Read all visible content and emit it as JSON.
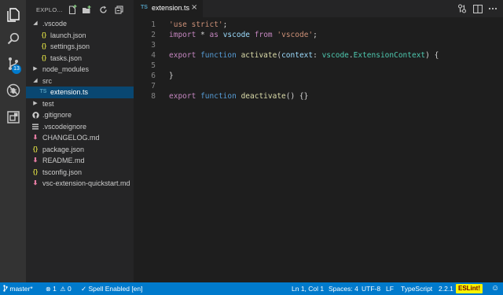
{
  "colors": {
    "activity_bar": "#333333",
    "sidebar": "#252526",
    "editor": "#1e1e1e",
    "selection": "#094771",
    "status_bar": "#007acc",
    "badge": "#007acc",
    "eslint_bg": "#f9f300",
    "eslint_fg": "#6c0000"
  },
  "activity": {
    "items": [
      {
        "icon": "files-icon"
      },
      {
        "icon": "search-icon"
      },
      {
        "icon": "source-control-icon",
        "badge": "13"
      },
      {
        "icon": "debug-icon"
      },
      {
        "icon": "extensions-icon"
      }
    ]
  },
  "sidebar": {
    "title": "EXPLO...",
    "header_icons": [
      "new-file-icon",
      "new-folder-icon",
      "refresh-icon",
      "collapse-all-icon"
    ],
    "tree": [
      {
        "label": ".vscode",
        "type": "folder",
        "expanded": true
      },
      {
        "label": "launch.json",
        "type": "json"
      },
      {
        "label": "settings.json",
        "type": "json"
      },
      {
        "label": "tasks.json",
        "type": "json"
      },
      {
        "label": "node_modules",
        "type": "folder",
        "expanded": false
      },
      {
        "label": "src",
        "type": "folder",
        "expanded": true
      },
      {
        "label": "extension.ts",
        "type": "ts",
        "selected": true
      },
      {
        "label": "test",
        "type": "folder",
        "expanded": false
      },
      {
        "label": ".gitignore",
        "type": "git"
      },
      {
        "label": ".vscodeignore",
        "type": "list"
      },
      {
        "label": "CHANGELOG.md",
        "type": "md"
      },
      {
        "label": "package.json",
        "type": "json"
      },
      {
        "label": "README.md",
        "type": "md"
      },
      {
        "label": "tsconfig.json",
        "type": "json"
      },
      {
        "label": "vsc-extension-quickstart.md",
        "type": "md"
      }
    ]
  },
  "tab": {
    "badge": "TS",
    "label": "extension.ts",
    "close": "×",
    "tools": [
      "open-changes-icon",
      "split-editor-icon",
      "more-icon"
    ]
  },
  "editor": {
    "line_numbers": [
      "1",
      "2",
      "3",
      "4",
      "5",
      "6",
      "7",
      "8"
    ],
    "lines": [
      [
        {
          "t": "'use strict'",
          "c": "str"
        },
        {
          "t": ";",
          "c": "plain"
        }
      ],
      [
        {
          "t": "import",
          "c": "kw"
        },
        {
          "t": " * ",
          "c": "plain"
        },
        {
          "t": "as",
          "c": "kw"
        },
        {
          "t": " ",
          "c": "plain"
        },
        {
          "t": "vscode",
          "c": "var"
        },
        {
          "t": " ",
          "c": "plain"
        },
        {
          "t": "from",
          "c": "kw"
        },
        {
          "t": " ",
          "c": "plain"
        },
        {
          "t": "'vscode'",
          "c": "str"
        },
        {
          "t": ";",
          "c": "plain"
        }
      ],
      [],
      [
        {
          "t": "export",
          "c": "kw"
        },
        {
          "t": " ",
          "c": "plain"
        },
        {
          "t": "function",
          "c": "kw2"
        },
        {
          "t": " ",
          "c": "plain"
        },
        {
          "t": "activate",
          "c": "fn"
        },
        {
          "t": "(",
          "c": "plain"
        },
        {
          "t": "context",
          "c": "var"
        },
        {
          "t": ": ",
          "c": "plain"
        },
        {
          "t": "vscode",
          "c": "type"
        },
        {
          "t": ".",
          "c": "plain"
        },
        {
          "t": "ExtensionContext",
          "c": "type"
        },
        {
          "t": ") {",
          "c": "plain"
        }
      ],
      [],
      [
        {
          "t": "}",
          "c": "plain"
        }
      ],
      [],
      [
        {
          "t": "export",
          "c": "kw"
        },
        {
          "t": " ",
          "c": "plain"
        },
        {
          "t": "function",
          "c": "kw2"
        },
        {
          "t": " ",
          "c": "plain"
        },
        {
          "t": "deactivate",
          "c": "fn"
        },
        {
          "t": "() {}",
          "c": "plain"
        }
      ]
    ]
  },
  "status": {
    "branch": "master*",
    "errors": "1",
    "warnings": "0",
    "spell": "Spell Enabled [en]",
    "position": "Ln 1, Col 1",
    "spaces": "Spaces: 4",
    "encoding": "UTF-8",
    "eol": "LF",
    "language": "TypeScript",
    "version": "2.2.1",
    "eslint": "ESLint!",
    "smiley": "☺"
  }
}
